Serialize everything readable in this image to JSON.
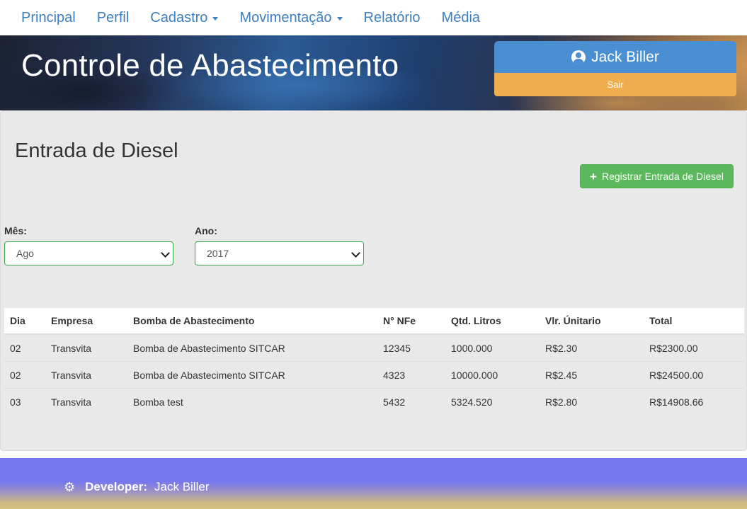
{
  "nav": {
    "items": [
      {
        "label": "Principal",
        "dropdown": false
      },
      {
        "label": "Perfil",
        "dropdown": false
      },
      {
        "label": "Cadastro",
        "dropdown": true
      },
      {
        "label": "Movimentação",
        "dropdown": true
      },
      {
        "label": "Relatório",
        "dropdown": false
      },
      {
        "label": "Média",
        "dropdown": false
      }
    ]
  },
  "header": {
    "title": "Controle de Abastecimento",
    "user_name": "Jack Biller",
    "logout_label": "Sair",
    "user_icon": "user-circle-icon"
  },
  "main": {
    "title": "Entrada de Diesel",
    "add_button_label": "Registrar Entrada de Diesel",
    "add_icon": "plus-icon",
    "month_label": "Mês:",
    "month_value": "Ago",
    "year_label": "Ano:",
    "year_value": "2017"
  },
  "table": {
    "headers": [
      "Dia",
      "Empresa",
      "Bomba de Abastecimento",
      "N° NFe",
      "Qtd. Litros",
      "Vlr. Únitario",
      "Total"
    ],
    "rows": [
      [
        "02",
        "Transvita",
        "Bomba de Abastecimento SITCAR",
        "12345",
        "1000.000",
        "R$2.30",
        "R$2300.00"
      ],
      [
        "02",
        "Transvita",
        "Bomba de Abastecimento SITCAR",
        "4323",
        "10000.000",
        "R$2.45",
        "R$24500.00"
      ],
      [
        "03",
        "Transvita",
        "Bomba test",
        "5432",
        "5324.520",
        "R$2.80",
        "R$14908.66"
      ]
    ]
  },
  "footer": {
    "label": "Developer:",
    "name": "Jack Biller",
    "icon": "gear-icon"
  },
  "colors": {
    "nav_link": "#3d7fc1",
    "user_button": "#4a8fd1",
    "logout_button": "#f0ad4e",
    "add_button": "#5cb85c",
    "footer": "#7476ee"
  }
}
